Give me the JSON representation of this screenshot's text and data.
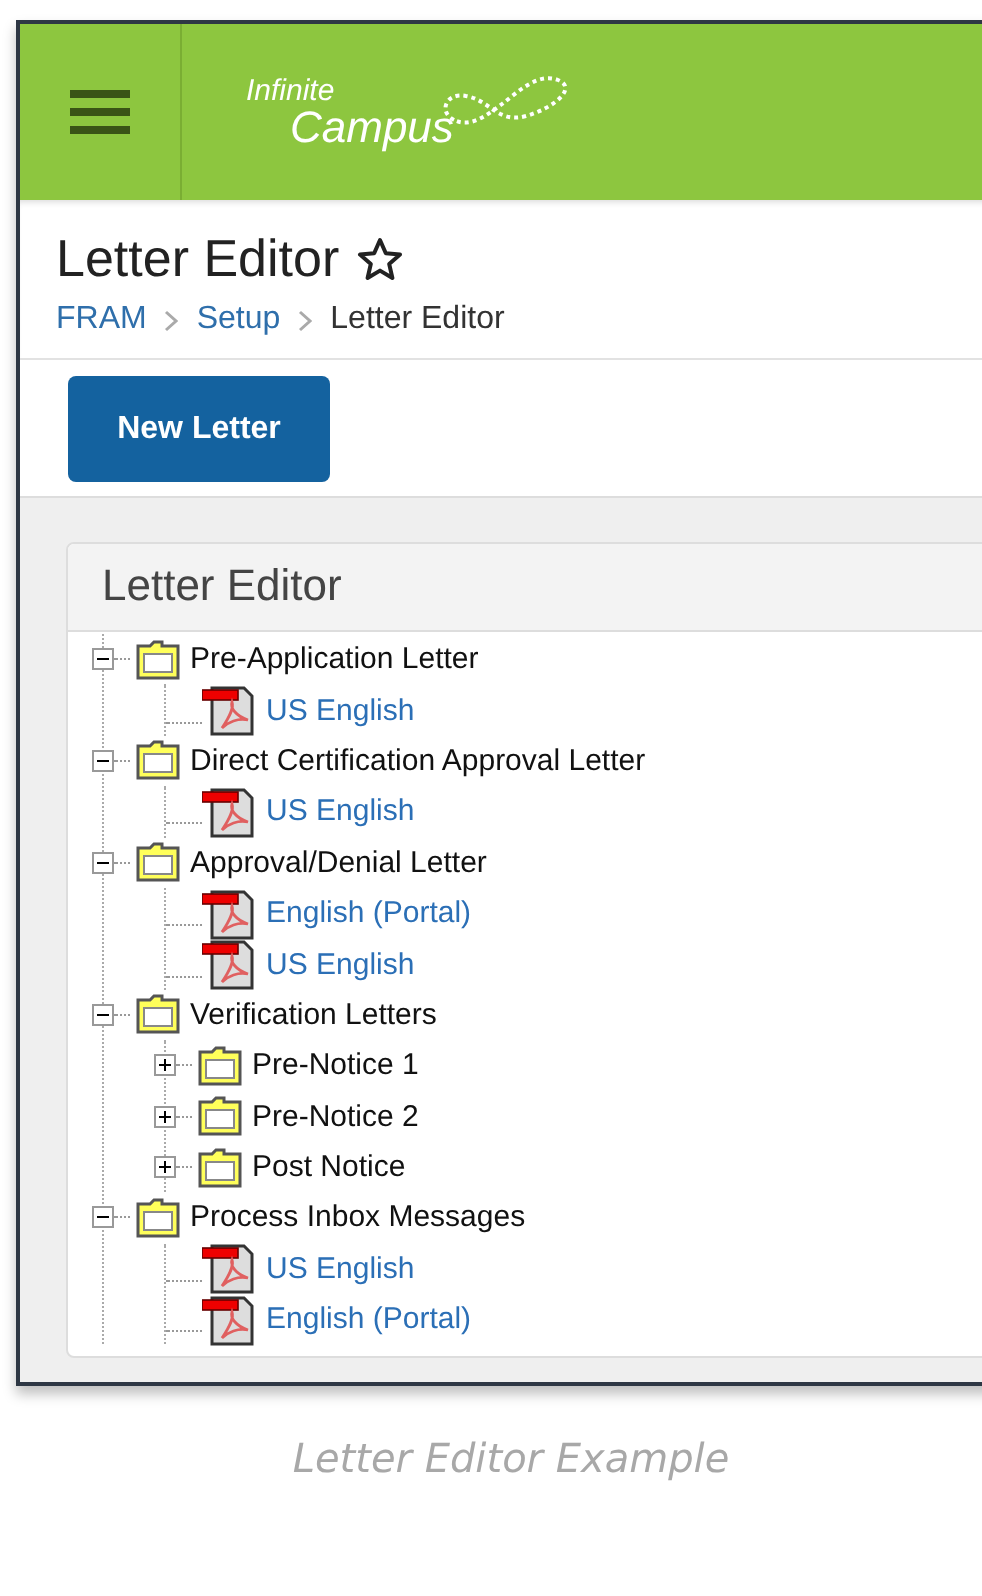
{
  "header": {
    "logo": {
      "line1": "Infinite",
      "line2": "Campus"
    }
  },
  "page": {
    "title": "Letter Editor",
    "favorite": false,
    "breadcrumb": [
      {
        "label": "FRAM",
        "link": true
      },
      {
        "label": "Setup",
        "link": true
      },
      {
        "label": "Letter Editor",
        "link": false
      }
    ]
  },
  "toolbar": {
    "button": "New Letter"
  },
  "panel": {
    "title": "Letter Editor",
    "tree": [
      {
        "kind": "folder",
        "label": "Pre-Application Letter",
        "expanded": true,
        "children": [
          {
            "kind": "file",
            "label": "US English"
          }
        ]
      },
      {
        "kind": "folder",
        "label": "Direct Certification Approval Letter",
        "expanded": true,
        "children": [
          {
            "kind": "file",
            "label": "US English"
          }
        ]
      },
      {
        "kind": "folder",
        "label": "Approval/Denial Letter",
        "expanded": true,
        "children": [
          {
            "kind": "file",
            "label": "English (Portal)"
          },
          {
            "kind": "file",
            "label": "US English"
          }
        ]
      },
      {
        "kind": "folder",
        "label": "Verification Letters",
        "expanded": true,
        "children": [
          {
            "kind": "folder",
            "label": "Pre-Notice 1",
            "expanded": false
          },
          {
            "kind": "folder",
            "label": "Pre-Notice 2",
            "expanded": false
          },
          {
            "kind": "folder",
            "label": "Post Notice",
            "expanded": false
          }
        ]
      },
      {
        "kind": "folder",
        "label": "Process Inbox Messages",
        "expanded": true,
        "children": [
          {
            "kind": "file",
            "label": "US English"
          },
          {
            "kind": "file",
            "label": "English (Portal)"
          }
        ]
      }
    ]
  },
  "caption": "Letter Editor Example"
}
